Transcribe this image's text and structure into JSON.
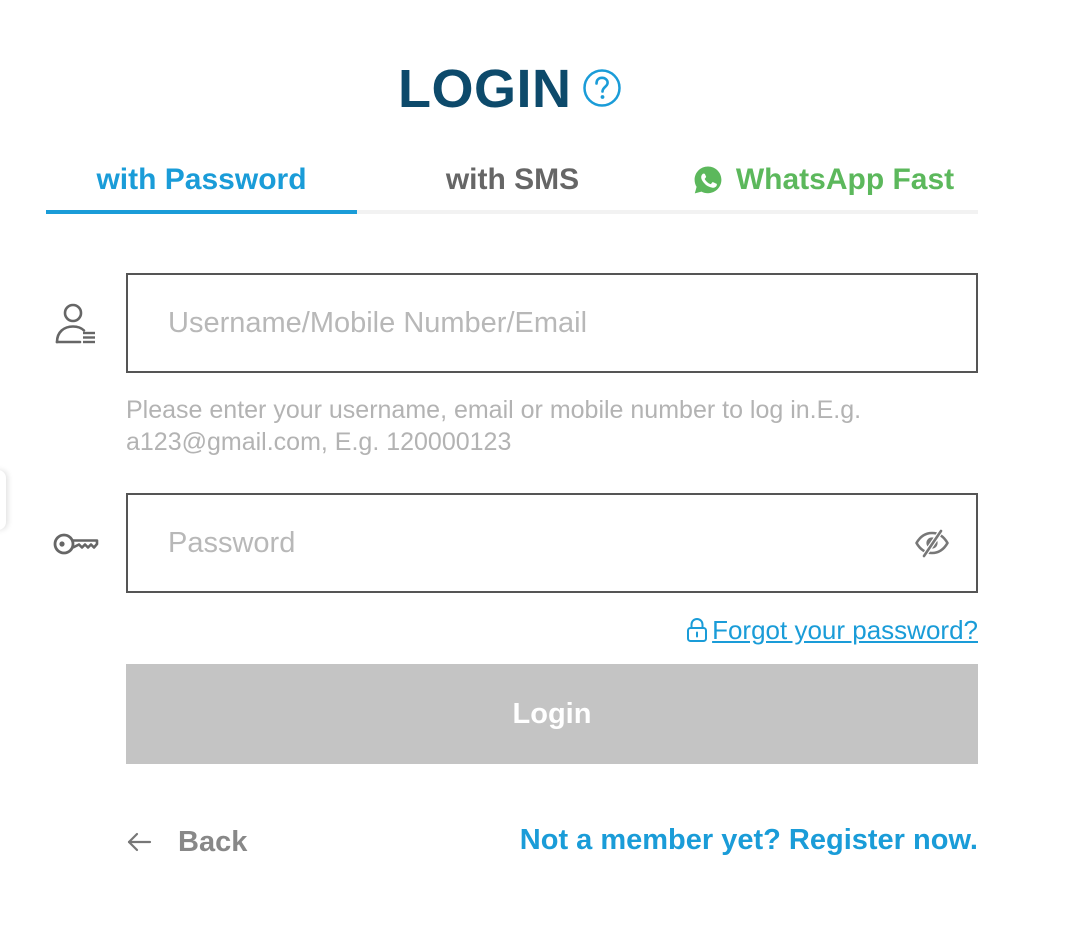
{
  "header": {
    "title": "LOGIN",
    "help_icon": "question-circle-icon"
  },
  "tabs": [
    {
      "label": "with Password",
      "active": true
    },
    {
      "label": "with SMS",
      "active": false
    },
    {
      "label": "WhatsApp Fast",
      "active": false,
      "icon": "whatsapp-icon"
    }
  ],
  "form": {
    "username": {
      "placeholder": "Username/Mobile Number/Email",
      "value": "",
      "icon": "user-icon"
    },
    "hint": "Please enter your username, email or mobile number to log in.E.g. a123@gmail.com, E.g. 120000123",
    "password": {
      "placeholder": "Password",
      "value": "",
      "icon": "key-icon",
      "toggle_icon": "eye-hidden-icon"
    },
    "forgot_label": "Forgot your password?",
    "login_label": "Login"
  },
  "footer": {
    "back_label": "Back",
    "register_label": "Not a member yet? Register now."
  },
  "colors": {
    "title": "#0d4a6b",
    "accent": "#1a9cd8",
    "whatsapp": "#5cb85c",
    "button_disabled": "#c4c4c4",
    "muted": "#b3b3b3"
  }
}
